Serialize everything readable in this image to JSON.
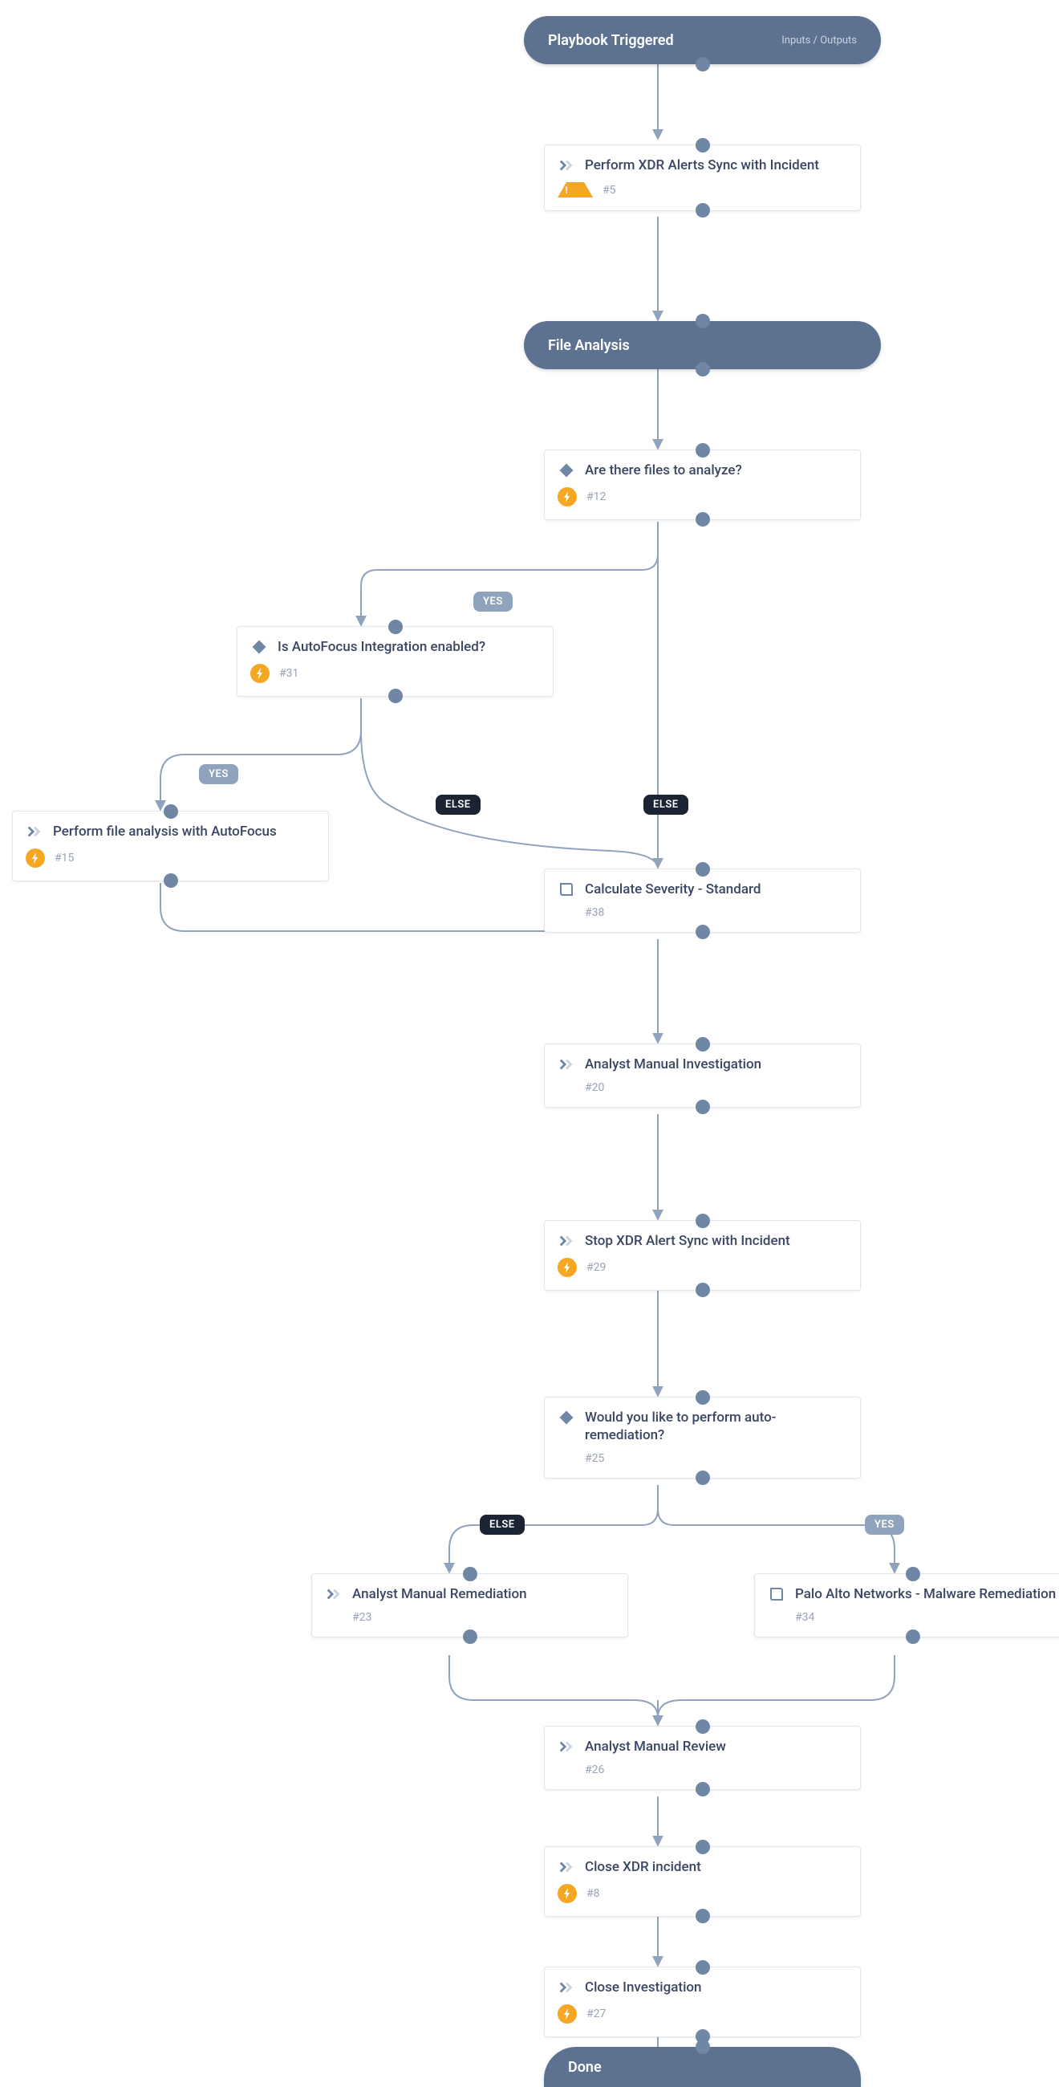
{
  "colors": {
    "pill": "#5d7290",
    "edge": "#8fa3bd",
    "port": "#6f86a5",
    "badgeOrange": "#f5a623",
    "labelElse": "#1a2433"
  },
  "pills": {
    "trigger": {
      "label": "Playbook Triggered",
      "sublabel": "Inputs / Outputs"
    },
    "section_file": {
      "label": "File Analysis"
    },
    "done": {
      "label": "Done"
    }
  },
  "cards": {
    "sync": {
      "title": "Perform XDR Alerts Sync with Incident",
      "id": "#5",
      "leadIcon": "chevrons",
      "badge": "warning"
    },
    "filesQ": {
      "title": "Are there files to analyze?",
      "id": "#12",
      "leadIcon": "diamond",
      "badge": "bolt"
    },
    "afQ": {
      "title": "Is AutoFocus Integration enabled?",
      "id": "#31",
      "leadIcon": "diamond",
      "badge": "bolt"
    },
    "afRun": {
      "title": "Perform file analysis with AutoFocus",
      "id": "#15",
      "leadIcon": "chevrons",
      "badge": "bolt"
    },
    "severity": {
      "title": "Calculate Severity - Standard",
      "id": "#38",
      "leadIcon": "book",
      "badge": null
    },
    "investigate": {
      "title": "Analyst Manual Investigation",
      "id": "#20",
      "leadIcon": "chevrons",
      "badge": null
    },
    "stopSync": {
      "title": "Stop XDR Alert Sync with Incident",
      "id": "#29",
      "leadIcon": "chevrons",
      "badge": "bolt"
    },
    "remedQ": {
      "title": "Would you like to perform auto-remediation?",
      "id": "#25",
      "leadIcon": "diamond",
      "badge": null
    },
    "manRemed": {
      "title": "Analyst Manual Remediation",
      "id": "#23",
      "leadIcon": "chevrons",
      "badge": null
    },
    "panRemed": {
      "title": "Palo Alto Networks - Malware Remediation",
      "id": "#34",
      "leadIcon": "book",
      "badge": null
    },
    "review": {
      "title": "Analyst Manual Review",
      "id": "#26",
      "leadIcon": "chevrons",
      "badge": null
    },
    "closeXdr": {
      "title": "Close XDR incident",
      "id": "#8",
      "leadIcon": "chevrons",
      "badge": "bolt"
    },
    "closeInv": {
      "title": "Close Investigation",
      "id": "#27",
      "leadIcon": "chevrons",
      "badge": "bolt"
    }
  },
  "labels": {
    "yes": "YES",
    "else": "ELSE"
  }
}
